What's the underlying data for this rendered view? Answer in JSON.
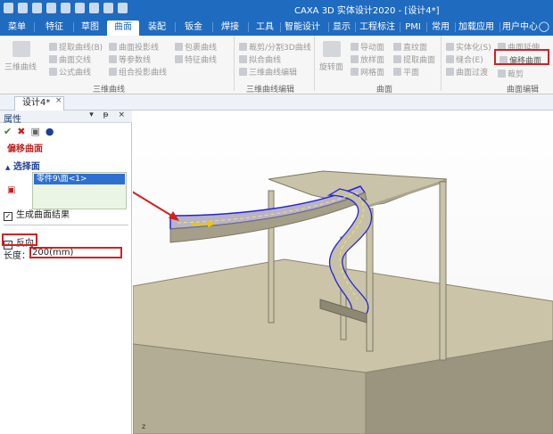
{
  "window": {
    "title": "CAXA 3D 实体设计2020 - [设计4*]"
  },
  "tabs": [
    {
      "label": "菜单"
    },
    {
      "label": "特征"
    },
    {
      "label": "草图"
    },
    {
      "label": "曲面",
      "active": true
    },
    {
      "label": "装配"
    },
    {
      "label": "钣金"
    },
    {
      "label": "焊接"
    },
    {
      "label": "工具"
    },
    {
      "label": "智能设计"
    },
    {
      "label": "显示"
    },
    {
      "label": "工程标注"
    },
    {
      "label": "PMI"
    },
    {
      "label": "常用"
    },
    {
      "label": "加载应用"
    },
    {
      "label": "用户中心"
    }
  ],
  "ribbon": {
    "curve3d": {
      "big": "三维曲线",
      "items": [
        "提取曲线(B)",
        "曲面交线",
        "公式曲线",
        "曲面投影线",
        "等参数线",
        "组合投影曲线",
        "包裹曲线",
        "特征曲线"
      ],
      "group": "三维曲线"
    },
    "curve_edit": {
      "items": [
        "裁剪/分割3D曲线",
        "拟合曲线",
        "三维曲线编辑"
      ],
      "group": "三维曲线编辑"
    },
    "surface": {
      "big": "旋转面",
      "items": [
        "导动面",
        "放样面",
        "网格面",
        "直纹面",
        "提取曲面",
        "平面"
      ],
      "group": "曲面"
    },
    "surface_edit": {
      "items": [
        "实体化(S)",
        "缝合(E)",
        "曲面过渡",
        "曲面延伸",
        "偏移曲面",
        "裁剪"
      ],
      "group": "曲面编辑"
    }
  },
  "doc_tab": {
    "label": "设计4*",
    "close": "×"
  },
  "panel": {
    "title": "属性",
    "header_controls": "▾ ᵽ ×",
    "section_title": "偏移曲面",
    "subsection_title": "选择面",
    "selected_face": "零件9\\面<1>",
    "generate_label": "生成曲面结果",
    "reverse_label": "反向",
    "length_label": "长度：",
    "length_value": "200(mm)"
  },
  "viewport": {
    "axis_label": "z"
  },
  "colors": {
    "title_bar": "#1f6bbf",
    "highlight_red": "#d42020",
    "selection_blue": "#2f6fd0",
    "model_tan": "#cbc4a8"
  }
}
